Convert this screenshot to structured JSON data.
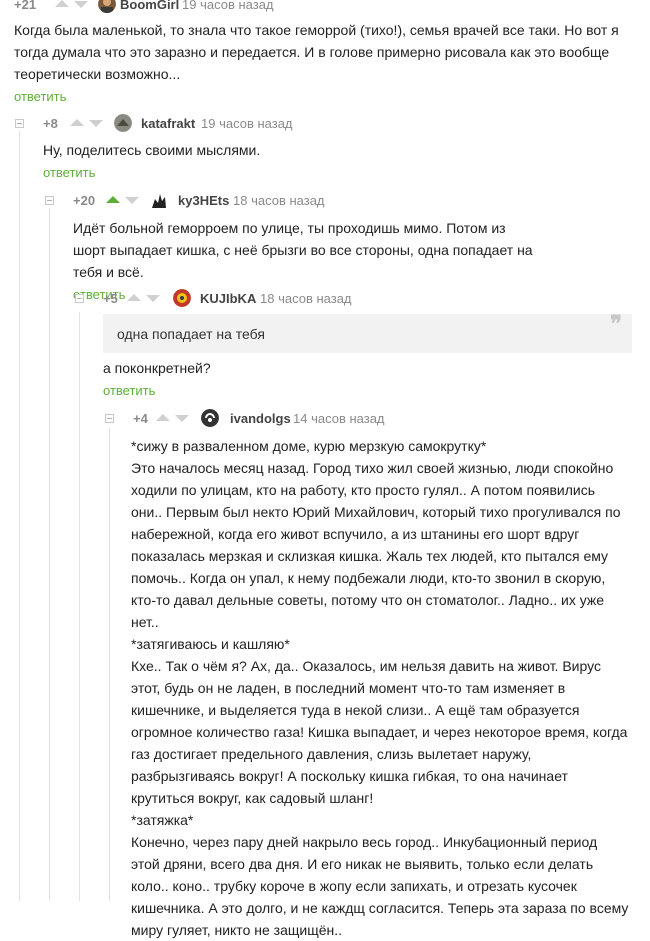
{
  "comments": [
    {
      "rating": "+21",
      "username": "BoomGirl",
      "time": "19 часов назад",
      "text": [
        "Когда была маленькой, то знала что такое геморрой (тихо!), семья врачей все таки. Но вот я тогда думала что это заразно и передается. И в голове примерно рисовала как это вообще теоретически возможно..."
      ],
      "reply": "ответить"
    },
    {
      "rating": "+8",
      "username": "katafrakt",
      "time": "19 часов назад",
      "text": [
        "Ну, поделитесь своими мыслями."
      ],
      "reply": "ответить"
    },
    {
      "rating": "+20",
      "username": "ky3HEts",
      "time": "18 часов назад",
      "text": [
        "Идёт больной геморроем по улице, ты проходишь мимо. Потом из шорт выпадает кишка, с неё брызги во все стороны, одна попадает на тебя и всё."
      ],
      "reply": "ответить"
    },
    {
      "rating": "+5",
      "username": "KUJIbKA",
      "time": "18 часов назад",
      "quote": "одна попадает на тебя",
      "quote_mark": "❞",
      "text": [
        "а поконкретней?"
      ],
      "reply": "ответить"
    },
    {
      "rating": "+4",
      "username": "ivandolgs",
      "time": "14 часов назад",
      "text": [
        "*сижу в разваленном доме, курю мерзкую самокрутку*",
        "Это началось месяц назад. Город тихо жил своей жизнью, люди спокойно ходили по улицам, кто на работу, кто просто гулял.. А потом появились они.. Первым был некто Юрий Михайлович, который тихо прогуливался по набережной, когда его живот вспучило, а из штанины его шорт вдруг показалась мерзкая и склизкая кишка. Жаль тех людей, кто пытался ему помочь..  Когда он упал, к нему подбежали люди, кто-то звонил в скорую, кто-то давал дельные советы, потому что он стоматолог.. Ладно.. их уже нет..",
        "*затягиваюсь и кашляю*",
        "Кхе.. Так о чём я? Ах, да..  Оказалось, им нельзя давить на живот. Вирус этот, будь он не ладен, в последний момент что-то там изменяет в кишечнике, и выделяется туда в некой слизи.. А ещё там образуется огромное количество газа! Кишка выпадает, и через некоторое время, когда газ достигает предельного давления, слизь вылетает наружу, разбрызгиваясь вокруг! А поскольку кишка гибкая, то она начинает крутиться вокруг, как садовый шланг!",
        "*затяжка*",
        "Конечно, через пару дней накрыло весь город.. Инкубационный период этой дряни, всего два дня. И его никак не выявить, только если делать коло.. коно.. трубку короче в жопу если запихать, и отрезать кусочек кишечника. А это долго, и не каждщ согласится. Теперь эта зараза по всему миру гуляет, никто не защищён.."
      ]
    }
  ],
  "colors": {
    "accent": "#5fae3a",
    "meta": "#8a8a8a",
    "quote_bg": "#f2f2f2"
  }
}
